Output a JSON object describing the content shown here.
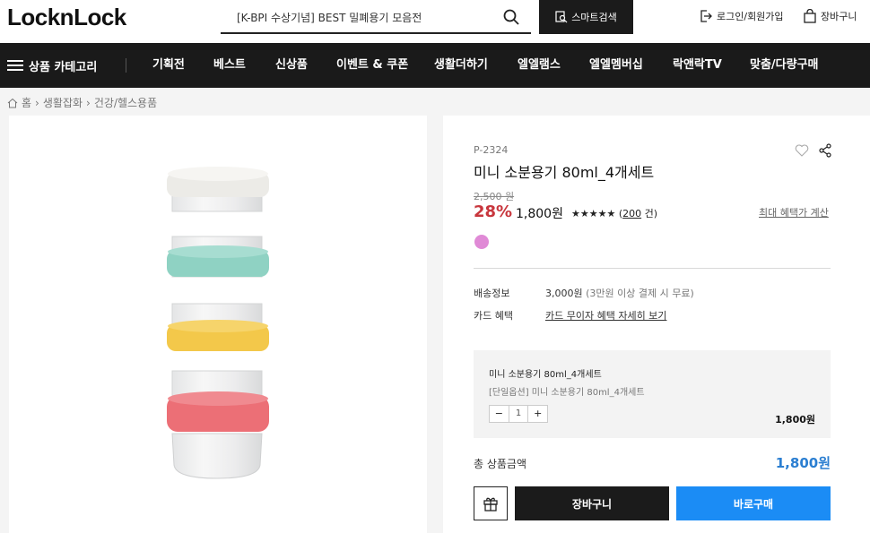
{
  "header": {
    "logo": "LocknLock",
    "search_value": "[K-BPI 수상기념] BEST 밀폐용기 모음전",
    "smart_search": "스마트검색",
    "login": "로그인/회원가입",
    "cart": "장바구니"
  },
  "nav": {
    "category": "상품 카테고리",
    "items": [
      "기획전",
      "베스트",
      "신상품",
      "이벤트 & 쿠폰",
      "생활더하기",
      "엘엘램스",
      "엘엘멤버십",
      "락앤락TV",
      "맞춤/다량구매"
    ]
  },
  "breadcrumb": [
    "홈",
    "생활잡화",
    "건강/헬스용품"
  ],
  "product": {
    "code": "P-2324",
    "title": "미니 소분용기 80ml_4개세트",
    "original_price": "2,500 원",
    "discount": "28%",
    "price": "1,800원",
    "stars": "★★★★★",
    "review_open": "(",
    "review_count": "200",
    "review_close": " 건)",
    "benefit_link": "최대 혜택가 계산",
    "swatch_color": "#e08ad6",
    "lid_colors": [
      "#ecebe7",
      "#8fd2c3",
      "#f3c84a",
      "#ec6f76"
    ]
  },
  "shipping": {
    "label": "배송정보",
    "value": "3,000원",
    "note": "(3만원 이상 결제 시 무료)"
  },
  "card": {
    "label": "카드 혜택",
    "link": "카드 무이자 혜택 자세히 보기"
  },
  "option": {
    "name": "미니 소분용기 80ml_4개세트",
    "sub": "[단일옵션] 미니 소분용기 80ml_4개세트",
    "minus": "−",
    "qty": "1",
    "plus": "+",
    "price": "1,800원"
  },
  "total": {
    "label": "총 상품금액",
    "value": "1,800원"
  },
  "buttons": {
    "cart": "장바구니",
    "buy": "바로구매"
  }
}
